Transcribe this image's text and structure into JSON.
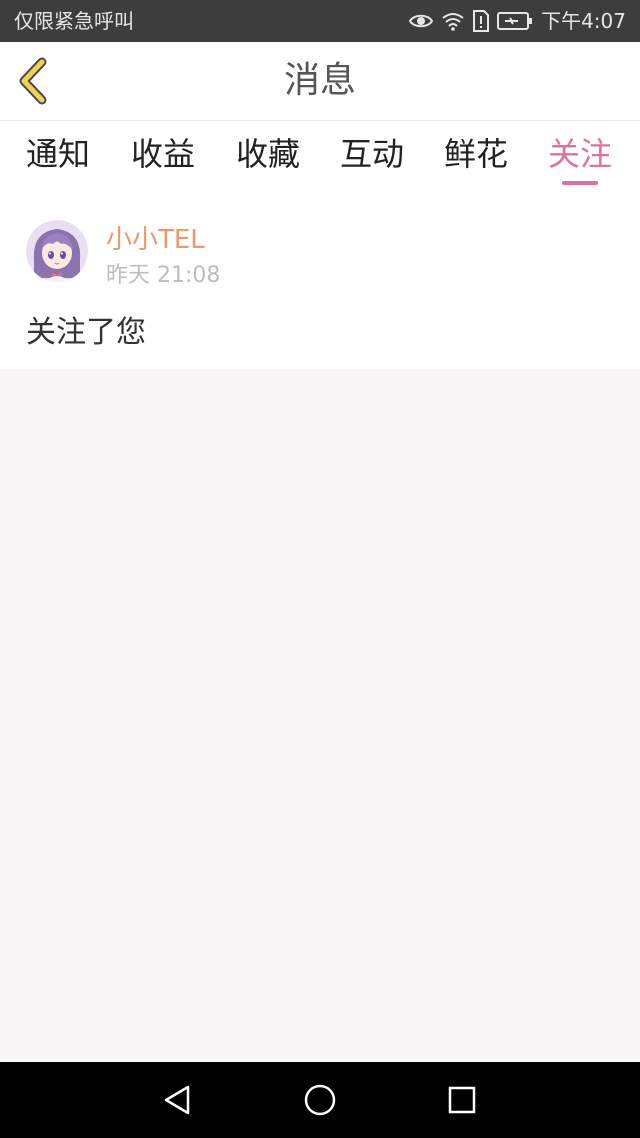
{
  "status_bar": {
    "carrier_text": "仅限紧急呼叫",
    "time": "下午4:07",
    "icons": [
      "eye-icon",
      "wifi-icon",
      "sim-alert-icon",
      "battery-charging-icon"
    ]
  },
  "header": {
    "title": "消息",
    "back_icon": "chevron-left-icon",
    "back_color": "#f0cf5a"
  },
  "tabs": [
    {
      "label": "通知",
      "active": false
    },
    {
      "label": "收益",
      "active": false
    },
    {
      "label": "收藏",
      "active": false
    },
    {
      "label": "互动",
      "active": false
    },
    {
      "label": "鲜花",
      "active": false
    },
    {
      "label": "关注",
      "active": true
    }
  ],
  "accent_color": "#e0709f",
  "messages": [
    {
      "avatar": "anime-girl-avatar",
      "username": "小小TEL",
      "time": "昨天 21:08",
      "text": "关注了您"
    }
  ],
  "nav_bar": {
    "buttons": [
      "back-triangle-icon",
      "home-circle-icon",
      "recents-square-icon"
    ]
  }
}
